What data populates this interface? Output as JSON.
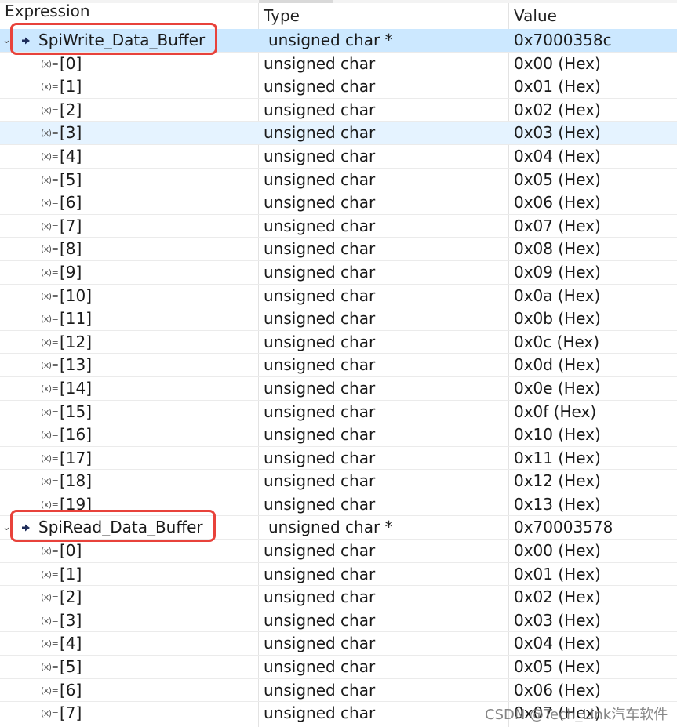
{
  "columns": {
    "expression": "Expression",
    "type": "Type",
    "value": "Value"
  },
  "groups": [
    {
      "name": "SpiWrite_Data_Buffer",
      "type": "unsigned char *",
      "value": "0x7000358c",
      "children": [
        {
          "index": "[0]",
          "type": "unsigned char",
          "value": "0x00 (Hex)"
        },
        {
          "index": "[1]",
          "type": "unsigned char",
          "value": "0x01 (Hex)"
        },
        {
          "index": "[2]",
          "type": "unsigned char",
          "value": "0x02 (Hex)"
        },
        {
          "index": "[3]",
          "type": "unsigned char",
          "value": "0x03 (Hex)"
        },
        {
          "index": "[4]",
          "type": "unsigned char",
          "value": "0x04 (Hex)"
        },
        {
          "index": "[5]",
          "type": "unsigned char",
          "value": "0x05 (Hex)"
        },
        {
          "index": "[6]",
          "type": "unsigned char",
          "value": "0x06 (Hex)"
        },
        {
          "index": "[7]",
          "type": "unsigned char",
          "value": "0x07 (Hex)"
        },
        {
          "index": "[8]",
          "type": "unsigned char",
          "value": "0x08 (Hex)"
        },
        {
          "index": "[9]",
          "type": "unsigned char",
          "value": "0x09 (Hex)"
        },
        {
          "index": "[10]",
          "type": "unsigned char",
          "value": "0x0a (Hex)"
        },
        {
          "index": "[11]",
          "type": "unsigned char",
          "value": "0x0b (Hex)"
        },
        {
          "index": "[12]",
          "type": "unsigned char",
          "value": "0x0c (Hex)"
        },
        {
          "index": "[13]",
          "type": "unsigned char",
          "value": "0x0d (Hex)"
        },
        {
          "index": "[14]",
          "type": "unsigned char",
          "value": "0x0e (Hex)"
        },
        {
          "index": "[15]",
          "type": "unsigned char",
          "value": "0x0f (Hex)"
        },
        {
          "index": "[16]",
          "type": "unsigned char",
          "value": "0x10 (Hex)"
        },
        {
          "index": "[17]",
          "type": "unsigned char",
          "value": "0x11 (Hex)"
        },
        {
          "index": "[18]",
          "type": "unsigned char",
          "value": "0x12 (Hex)"
        },
        {
          "index": "[19]",
          "type": "unsigned char",
          "value": "0x13 (Hex)"
        }
      ]
    },
    {
      "name": "SpiRead_Data_Buffer",
      "type": "unsigned char *",
      "value": "0x70003578",
      "children": [
        {
          "index": "[0]",
          "type": "unsigned char",
          "value": "0x00 (Hex)"
        },
        {
          "index": "[1]",
          "type": "unsigned char",
          "value": "0x01 (Hex)"
        },
        {
          "index": "[2]",
          "type": "unsigned char",
          "value": "0x02 (Hex)"
        },
        {
          "index": "[3]",
          "type": "unsigned char",
          "value": "0x03 (Hex)"
        },
        {
          "index": "[4]",
          "type": "unsigned char",
          "value": "0x04 (Hex)"
        },
        {
          "index": "[5]",
          "type": "unsigned char",
          "value": "0x05 (Hex)"
        },
        {
          "index": "[6]",
          "type": "unsigned char",
          "value": "0x06 (Hex)"
        },
        {
          "index": "[7]",
          "type": "unsigned char",
          "value": "0x07 (Hex)"
        }
      ]
    }
  ],
  "icons": {
    "expand": "chevron-down-icon",
    "pointer": "arrow-right-icon",
    "variable": "variable-icon",
    "variable_glyph": "(x)="
  },
  "highlight_color": "#e8423b",
  "selected_row_color": "#cce8ff",
  "watermark": "CSDN @Tech_Link汽车软件"
}
